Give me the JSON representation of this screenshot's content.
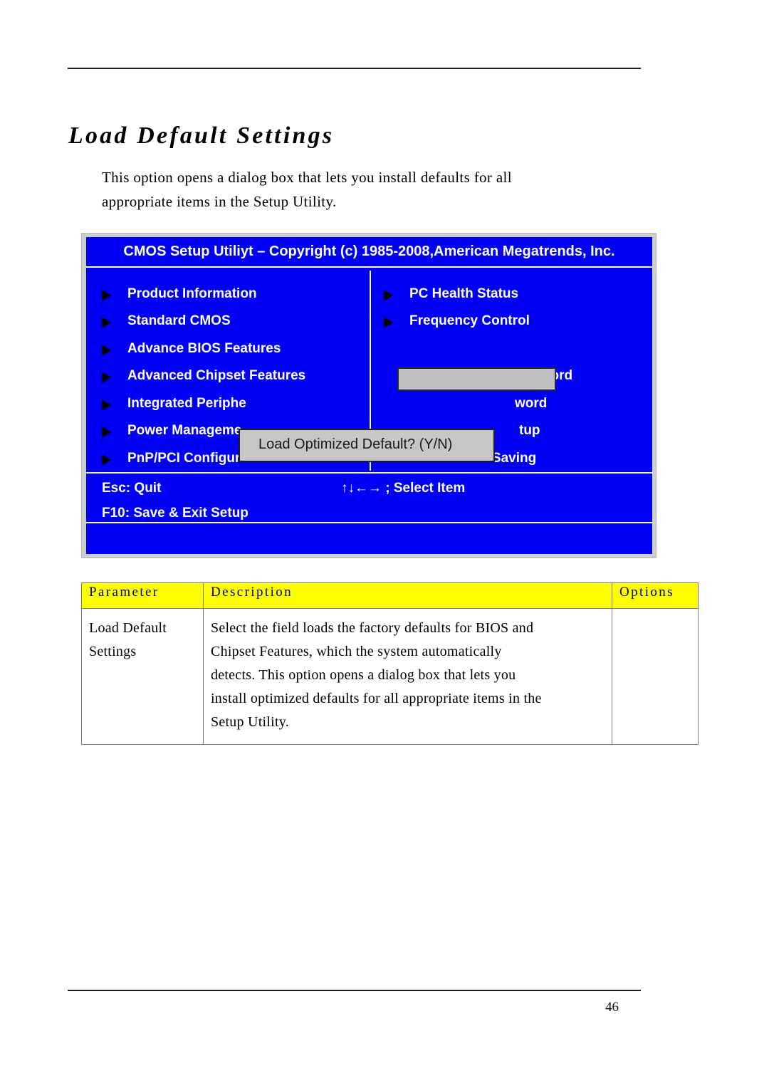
{
  "page": {
    "title": "Load Default Settings",
    "number": "46",
    "intro_lines": [
      "This option opens a dialog box that lets you install defaults for all",
      "appropriate items in the Setup Utility."
    ]
  },
  "bios": {
    "title": "CMOS Setup Utiliyt – Copyright (c) 1985-2008,American Megatrends, Inc.",
    "left_menu": [
      {
        "label": "Product Information",
        "arrow": true
      },
      {
        "label": "Standard CMOS",
        "arrow": true
      },
      {
        "label": "Advance BIOS Features",
        "arrow": true
      },
      {
        "label": "Advanced Chipset Features",
        "arrow": true
      },
      {
        "label": "Integrated Periphe",
        "arrow": true
      },
      {
        "label": "Power Manageme",
        "arrow": true
      },
      {
        "label": "PnP/PCI Configuration",
        "arrow": true
      }
    ],
    "right_menu": [
      {
        "label": "PC Health Status",
        "arrow": true
      },
      {
        "label": "Frequency Control",
        "arrow": true
      },
      {
        "label": "",
        "arrow": false
      },
      {
        "label": "Set Supervisor Password",
        "arrow": false
      },
      {
        "label": "word",
        "arrow": false
      },
      {
        "label": "tup",
        "arrow": false
      },
      {
        "label": "Exit Without Saving",
        "arrow": false
      }
    ],
    "selected_field_value": "",
    "dialog": {
      "message": "Load Optimized Default? (Y/N)"
    },
    "footer": {
      "esc": "Esc: Quit",
      "select": "↑↓←→ ; Select Item",
      "f10": "F10: Save & Exit Setup"
    },
    "colors": {
      "screen_blue": "#0000f4",
      "frame_grey": "#cfcfcf",
      "highlight_grey": "#c0c0c0",
      "dialog_grey": "#c6c6c6"
    }
  },
  "table": {
    "headers": [
      "Parameter",
      "Description",
      "Options"
    ],
    "rows": [
      {
        "parameter_lines": [
          "Load Default",
          "Settings"
        ],
        "description_lines": [
          "Select the field loads the factory defaults for BIOS and",
          "Chipset Features, which the system automatically",
          "detects. This option opens a dialog box that lets you",
          "install optimized defaults for all appropriate items in the",
          "Setup Utility."
        ],
        "options": ""
      }
    ],
    "header_color": "#ffff00"
  }
}
